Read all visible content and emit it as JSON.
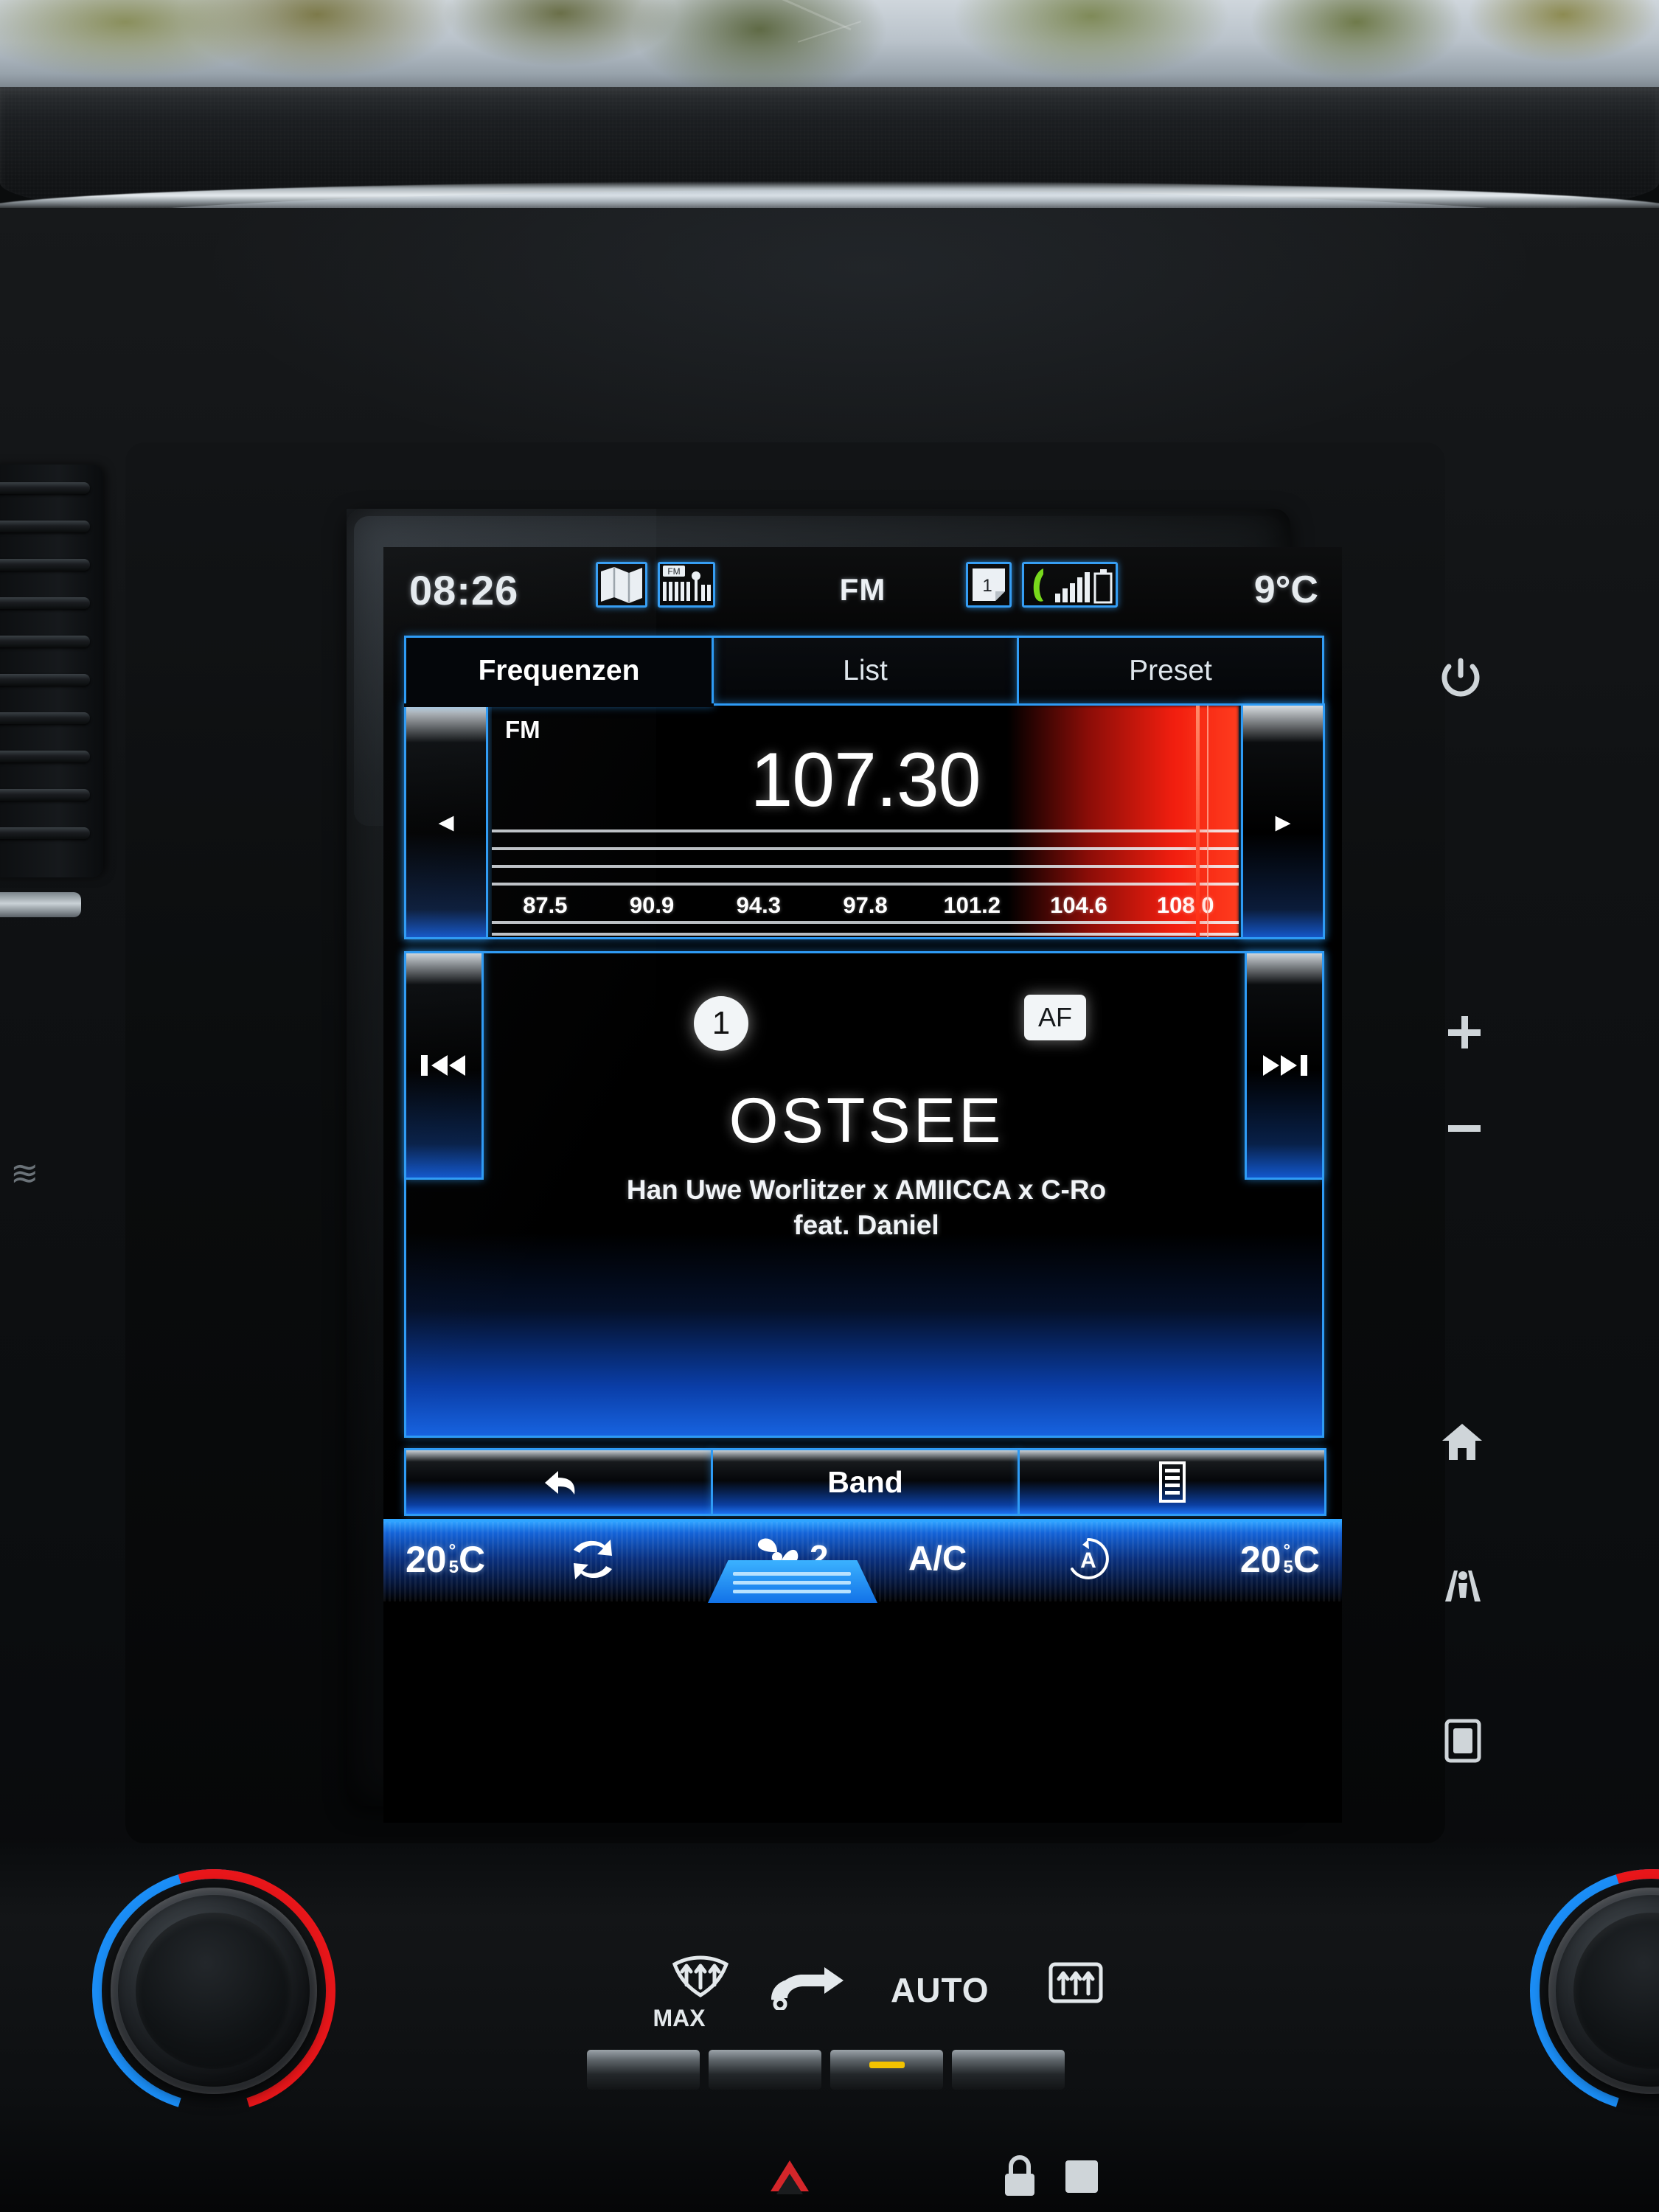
{
  "statusbar": {
    "clock": "08:26",
    "band": "FM",
    "outside_temp": "9°C",
    "page_indicator": "1",
    "icons": {
      "map": "map-icon",
      "radio": "fm-radio-icon",
      "phone": "phone-icon",
      "signal": "signal-bars-icon",
      "battery": "battery-icon"
    }
  },
  "tabs": [
    {
      "label": "Frequenzen",
      "active": true
    },
    {
      "label": "List",
      "active": false
    },
    {
      "label": "Preset",
      "active": false
    }
  ],
  "tuner": {
    "band_label": "FM",
    "frequency": "107.30",
    "prev_arrow": "◂",
    "next_arrow": "▸",
    "scale_labels": [
      "87.5",
      "90.9",
      "94.3",
      "97.8",
      "101.2",
      "104.6",
      "108.0"
    ],
    "cursor_position_percent": 94
  },
  "nowplaying": {
    "preset_number": "1",
    "af_badge": "AF",
    "station_name": "OSTSEE",
    "radio_text_line1": "Han   Uwe Worlitzer x AMIICCA x C-Ro",
    "radio_text_line2": "feat. Daniel",
    "prev_track": "⏮",
    "next_track": "⏭"
  },
  "softkeys": [
    {
      "label": "↩",
      "name": "back"
    },
    {
      "label": "Band",
      "name": "band"
    },
    {
      "label": "☰",
      "name": "menu"
    }
  ],
  "climate": {
    "left_temp": "20",
    "left_temp_frac": "5",
    "left_temp_unit": "C",
    "right_temp": "20",
    "right_temp_frac": "5",
    "right_temp_unit": "C",
    "fan_speed": "2",
    "ac_label": "A/C",
    "recirc_icon": "recirculation-icon",
    "fan_icon": "fan-icon",
    "auto_icon": "auto-climate-icon"
  },
  "hardkeys": {
    "power": "⏻",
    "volume_up": "+",
    "volume_down": "–",
    "home": "home-icon",
    "lane_assist": "lane-assist-icon",
    "media_card": "media-card-icon"
  },
  "hvac_panel": {
    "max_defrost_label": "MAX",
    "auto_label": "AUTO",
    "front_defrost_icon": "front-defrost-icon",
    "recirc_icon": "air-recirculation-icon",
    "rear_defrost_icon": "rear-defrost-icon",
    "hazard_icon": "hazard-triangle-icon",
    "lock_icon": "door-lock-icon"
  },
  "colors": {
    "accent_blue": "#2e9bf5",
    "tuner_red": "#ff200f",
    "climate_blue": "#1463d8",
    "text_white": "#ffffff",
    "knob_blue": "#1b8ef7",
    "knob_red": "#e8161a"
  }
}
